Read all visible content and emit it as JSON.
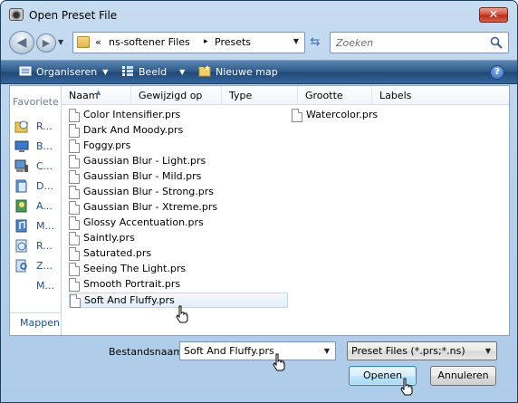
{
  "window": {
    "title": "Open Preset File",
    "close_glyph": "✕"
  },
  "navigation": {
    "back_glyph": "◀",
    "forward_glyph": "▶",
    "recent_glyph": "▼",
    "breadcrumb_overflow": "«",
    "breadcrumbs": [
      "ns-softener Files",
      "Presets"
    ],
    "crumb_separator": "▸",
    "address_dropdown": "▼",
    "refresh_glyph": "⇆",
    "search_placeholder": "Zoeken"
  },
  "toolbar": {
    "organize_label": "Organiseren",
    "view_label": "Beeld",
    "new_folder_label": "Nieuwe map",
    "caret": "▼",
    "help_glyph": "?"
  },
  "sidebar": {
    "title": "Favoriete",
    "items": [
      {
        "label": "R...",
        "icon": "recent-places-icon"
      },
      {
        "label": "B...",
        "icon": "desktop-icon"
      },
      {
        "label": "C...",
        "icon": "computer-icon"
      },
      {
        "label": "D...",
        "icon": "documents-icon"
      },
      {
        "label": "A...",
        "icon": "pictures-icon"
      },
      {
        "label": "M...",
        "icon": "music-icon"
      },
      {
        "label": "R...",
        "icon": "recently-changed-icon"
      },
      {
        "label": "Z...",
        "icon": "searches-icon"
      },
      {
        "label": "M...",
        "icon": "more-icon"
      }
    ],
    "folders_label": "Mappen"
  },
  "columns": [
    "Naam",
    "Gewijzigd op",
    "Type",
    "Grootte",
    "Labels"
  ],
  "files_col1": [
    "Color Intensifier.prs",
    "Dark And Moody.prs",
    "Foggy.prs",
    "Gaussian Blur - Light.prs",
    "Gaussian Blur - Mild.prs",
    "Gaussian Blur - Strong.prs",
    "Gaussian Blur - Xtreme.prs",
    "Glossy Accentuation.prs",
    "Saintly.prs",
    "Saturated.prs",
    "Seeing The Light.prs",
    "Smooth Portrait.prs",
    "Soft And Fluffy.prs"
  ],
  "files_col2": [
    "Watercolor.prs"
  ],
  "hovered_file": "Soft And Fluffy.prs",
  "footer": {
    "filename_label": "Bestandsnaam:",
    "filename_value": "Soft And Fluffy.prs",
    "filter_value": "Preset Files (*.prs;*.ns)",
    "dropdown_glyph": "▼",
    "open_label": "Openen",
    "cancel_label": "Annuleren"
  },
  "colors": {
    "toolbar_bg": "#2c5685",
    "link_blue": "#1e4e8c",
    "frame_bg": "#b8d1ea"
  }
}
